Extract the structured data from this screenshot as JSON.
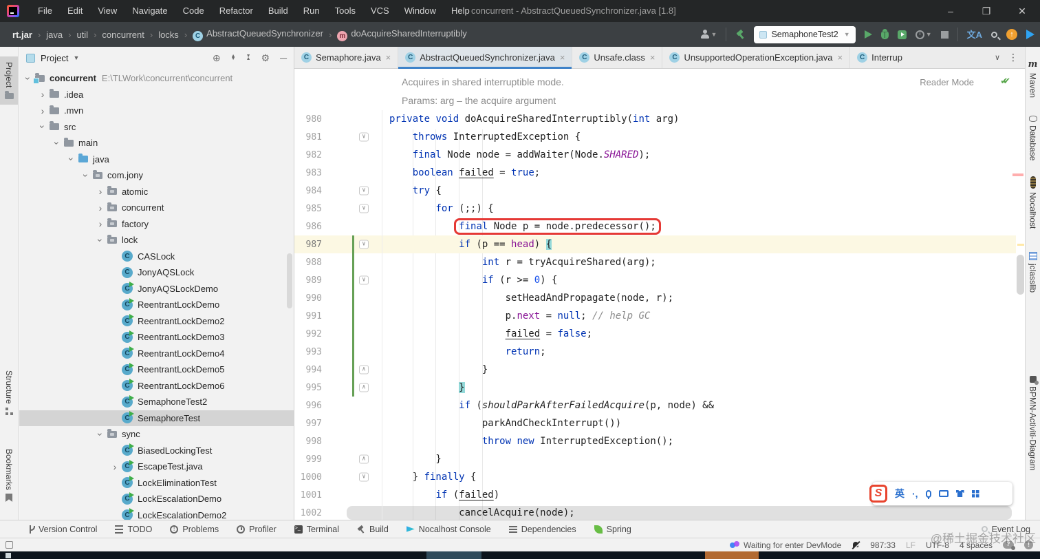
{
  "window": {
    "title": "concurrent - AbstractQueuedSynchronizer.java [1.8]",
    "menus": [
      "File",
      "Edit",
      "View",
      "Navigate",
      "Code",
      "Refactor",
      "Build",
      "Run",
      "Tools",
      "VCS",
      "Window",
      "Help"
    ],
    "controls": [
      "minimize",
      "maximize",
      "close"
    ]
  },
  "toolbar": {
    "breadcrumbs": [
      {
        "label": "rt.jar",
        "bold": true
      },
      {
        "label": "java"
      },
      {
        "label": "util"
      },
      {
        "label": "concurrent"
      },
      {
        "label": "locks"
      },
      {
        "label": "AbstractQueuedSynchronizer",
        "icon": "class"
      },
      {
        "label": "doAcquireSharedInterruptibly",
        "icon": "method"
      }
    ],
    "run_config": "SemaphoneTest2"
  },
  "tabs": {
    "items": [
      {
        "label": "Semaphore.java"
      },
      {
        "label": "AbstractQueuedSynchronizer.java",
        "active": true
      },
      {
        "label": "Unsafe.class"
      },
      {
        "label": "UnsupportedOperationException.java"
      },
      {
        "label": "Interrup",
        "partial": true
      }
    ]
  },
  "left_stripe": {
    "items": [
      "Project",
      "Structure",
      "Bookmarks"
    ]
  },
  "right_stripe": {
    "items": [
      "Maven",
      "Database",
      "Nocalhost",
      "jclasslib",
      "BPMN-Activiti-Diagram"
    ]
  },
  "project": {
    "header": "Project",
    "tree": [
      {
        "i": 0,
        "ch": "v",
        "icon": "folder-root",
        "label": "concurrent",
        "bold": true,
        "path": "E:\\TLWork\\concurrent\\concurrent"
      },
      {
        "i": 1,
        "ch": ">",
        "icon": "folder",
        "label": ".idea"
      },
      {
        "i": 1,
        "ch": ">",
        "icon": "folder",
        "label": ".mvn"
      },
      {
        "i": 1,
        "ch": "v",
        "icon": "folder",
        "label": "src"
      },
      {
        "i": 2,
        "ch": "v",
        "icon": "folder",
        "label": "main"
      },
      {
        "i": 3,
        "ch": "v",
        "icon": "folder-src",
        "label": "java"
      },
      {
        "i": 4,
        "ch": "v",
        "icon": "package",
        "label": "com.jony"
      },
      {
        "i": 5,
        "ch": ">",
        "icon": "package",
        "label": "atomic"
      },
      {
        "i": 5,
        "ch": ">",
        "icon": "package",
        "label": "concurrent"
      },
      {
        "i": 5,
        "ch": ">",
        "icon": "package",
        "label": "factory"
      },
      {
        "i": 5,
        "ch": "v",
        "icon": "package",
        "label": "lock"
      },
      {
        "i": 6,
        "ch": "",
        "icon": "class",
        "label": "CASLock"
      },
      {
        "i": 6,
        "ch": "",
        "icon": "class",
        "label": "JonyAQSLock"
      },
      {
        "i": 6,
        "ch": "",
        "icon": "class-run",
        "label": "JonyAQSLockDemo"
      },
      {
        "i": 6,
        "ch": "",
        "icon": "class-run",
        "label": "ReentrantLockDemo"
      },
      {
        "i": 6,
        "ch": "",
        "icon": "class-run",
        "label": "ReentrantLockDemo2"
      },
      {
        "i": 6,
        "ch": "",
        "icon": "class-run",
        "label": "ReentrantLockDemo3"
      },
      {
        "i": 6,
        "ch": "",
        "icon": "class-run",
        "label": "ReentrantLockDemo4"
      },
      {
        "i": 6,
        "ch": "",
        "icon": "class-run",
        "label": "ReentrantLockDemo5"
      },
      {
        "i": 6,
        "ch": "",
        "icon": "class-run",
        "label": "ReentrantLockDemo6"
      },
      {
        "i": 6,
        "ch": "",
        "icon": "class-run",
        "label": "SemaphoneTest2"
      },
      {
        "i": 6,
        "ch": "",
        "icon": "class-run",
        "label": "SemaphoreTest",
        "selected": true
      },
      {
        "i": 5,
        "ch": "v",
        "icon": "package",
        "label": "sync"
      },
      {
        "i": 6,
        "ch": "",
        "icon": "class-run",
        "label": "BiasedLockingTest"
      },
      {
        "i": 6,
        "ch": ">",
        "icon": "class-run",
        "label": "EscapeTest.java"
      },
      {
        "i": 6,
        "ch": "",
        "icon": "class-run",
        "label": "LockEliminationTest"
      },
      {
        "i": 6,
        "ch": "",
        "icon": "class-run",
        "label": "LockEscalationDemo"
      },
      {
        "i": 6,
        "ch": "",
        "icon": "class-run",
        "label": "LockEscalationDemo2"
      }
    ]
  },
  "editor": {
    "doc": [
      "Acquires in shared interruptible mode.",
      "Params: arg – the acquire argument"
    ],
    "reader_mode": "Reader Mode",
    "lines": [
      {
        "num": "980",
        "tokens": [
          {
            "c": "k",
            "t": "private"
          },
          {
            "t": " "
          },
          {
            "c": "k",
            "t": "void"
          },
          {
            "t": " doAcquireSharedInterruptibly("
          },
          {
            "c": "k",
            "t": "int"
          },
          {
            "t": " arg)"
          }
        ]
      },
      {
        "num": "981",
        "fold": "d",
        "tokens": [
          {
            "t": "    "
          },
          {
            "c": "k",
            "t": "throws"
          },
          {
            "t": " InterruptedException {"
          }
        ]
      },
      {
        "num": "982",
        "tokens": [
          {
            "t": "    "
          },
          {
            "c": "k",
            "t": "final"
          },
          {
            "t": " Node node = addWaiter(Node."
          },
          {
            "c": "sf",
            "t": "SHARED"
          },
          {
            "t": ");"
          }
        ]
      },
      {
        "num": "983",
        "tokens": [
          {
            "t": "    "
          },
          {
            "c": "k",
            "t": "boolean"
          },
          {
            "t": " "
          },
          {
            "c": "u",
            "t": "failed"
          },
          {
            "t": " = "
          },
          {
            "c": "k",
            "t": "true"
          },
          {
            "t": ";"
          }
        ]
      },
      {
        "num": "984",
        "fold": "d",
        "tokens": [
          {
            "t": "    "
          },
          {
            "c": "k",
            "t": "try"
          },
          {
            "t": " {"
          }
        ]
      },
      {
        "num": "985",
        "fold": "d",
        "tokens": [
          {
            "t": "        "
          },
          {
            "c": "k",
            "t": "for"
          },
          {
            "t": " (;;) {"
          }
        ]
      },
      {
        "num": "986",
        "tokens": [
          {
            "t": "            "
          },
          {
            "box": [
              {
                "c": "k",
                "t": "final"
              },
              {
                "t": " Node p = node.predecessor();"
              }
            ]
          }
        ]
      },
      {
        "num": "987",
        "fold": "d",
        "chg": true,
        "cur": true,
        "tokens": [
          {
            "t": "            "
          },
          {
            "c": "k",
            "t": "if"
          },
          {
            "t": " (p == "
          },
          {
            "c": "f",
            "t": "head"
          },
          {
            "t": ") "
          },
          {
            "c": "hl",
            "t": "{"
          }
        ]
      },
      {
        "num": "988",
        "chg": true,
        "tokens": [
          {
            "t": "                "
          },
          {
            "c": "k",
            "t": "int"
          },
          {
            "t": " r = tryAcquireShared(arg);"
          }
        ]
      },
      {
        "num": "989",
        "fold": "d",
        "chg": true,
        "tokens": [
          {
            "t": "                "
          },
          {
            "c": "k",
            "t": "if"
          },
          {
            "t": " (r >= "
          },
          {
            "c": "n",
            "t": "0"
          },
          {
            "t": ") {"
          }
        ]
      },
      {
        "num": "990",
        "chg": true,
        "tokens": [
          {
            "t": "                    setHeadAndPropagate(node, r);"
          }
        ]
      },
      {
        "num": "991",
        "chg": true,
        "tokens": [
          {
            "t": "                    p."
          },
          {
            "c": "f",
            "t": "next"
          },
          {
            "t": " = "
          },
          {
            "c": "k",
            "t": "null"
          },
          {
            "t": "; "
          },
          {
            "c": "c",
            "t": "// help GC"
          }
        ]
      },
      {
        "num": "992",
        "chg": true,
        "tokens": [
          {
            "t": "                    "
          },
          {
            "c": "u",
            "t": "failed"
          },
          {
            "t": " = "
          },
          {
            "c": "k",
            "t": "false"
          },
          {
            "t": ";"
          }
        ]
      },
      {
        "num": "993",
        "chg": true,
        "tokens": [
          {
            "t": "                    "
          },
          {
            "c": "k",
            "t": "return"
          },
          {
            "t": ";"
          }
        ]
      },
      {
        "num": "994",
        "fold": "u",
        "chg": true,
        "tokens": [
          {
            "t": "                }"
          }
        ]
      },
      {
        "num": "995",
        "fold": "u",
        "chg": true,
        "tokens": [
          {
            "t": "            "
          },
          {
            "c": "hl",
            "t": "}"
          }
        ]
      },
      {
        "num": "996",
        "tokens": [
          {
            "t": "            "
          },
          {
            "c": "k",
            "t": "if"
          },
          {
            "t": " ("
          },
          {
            "c": "sm",
            "t": "shouldParkAfterFailedAcquire"
          },
          {
            "t": "(p, node) &&"
          }
        ]
      },
      {
        "num": "997",
        "tokens": [
          {
            "t": "                parkAndCheckInterrupt())"
          }
        ]
      },
      {
        "num": "998",
        "tokens": [
          {
            "t": "                "
          },
          {
            "c": "k",
            "t": "throw"
          },
          {
            "t": " "
          },
          {
            "c": "k",
            "t": "new"
          },
          {
            "t": " InterruptedException();"
          }
        ]
      },
      {
        "num": "999",
        "fold": "u",
        "tokens": [
          {
            "t": "        }"
          }
        ]
      },
      {
        "num": "1000",
        "fold": "d",
        "tokens": [
          {
            "t": "    } "
          },
          {
            "c": "k",
            "t": "finally"
          },
          {
            "t": " {"
          }
        ]
      },
      {
        "num": "1001",
        "tokens": [
          {
            "t": "        "
          },
          {
            "c": "k",
            "t": "if"
          },
          {
            "t": " ("
          },
          {
            "c": "u",
            "t": "failed"
          },
          {
            "t": ")"
          }
        ]
      },
      {
        "num": "1002",
        "band": true,
        "tokens": [
          {
            "t": "            cancelAcquire(node);"
          }
        ]
      }
    ]
  },
  "bottom_bar": {
    "items": [
      {
        "label": "Version Control",
        "icon": "branch"
      },
      {
        "label": "TODO",
        "icon": "todo"
      },
      {
        "label": "Problems",
        "icon": "problems"
      },
      {
        "label": "Profiler",
        "icon": "profiler"
      },
      {
        "label": "Terminal",
        "icon": "terminal"
      },
      {
        "label": "Build",
        "icon": "hammer"
      },
      {
        "label": "Nocalhost Console",
        "icon": "nocalhost"
      },
      {
        "label": "Dependencies",
        "icon": "dependencies"
      },
      {
        "label": "Spring",
        "icon": "spring"
      }
    ],
    "event_log": "Event Log"
  },
  "status_bar": {
    "devmode": "Waiting for enter DevMode",
    "caret": "987:33",
    "line_sep": "LF",
    "encoding": "UTF-8",
    "indent": "4 spaces"
  },
  "ime": {
    "lang": "英",
    "punct": "·,"
  },
  "watermark": "@稀土掘金技术社区",
  "colors": {
    "accent_blue": "#3f83c9",
    "keyword": "#0033b3",
    "field": "#871094",
    "comment": "#8c8c8c",
    "number": "#1750eb",
    "run_green": "#59a869",
    "red_box": "#e53935",
    "current_line": "#fcf8e3"
  }
}
